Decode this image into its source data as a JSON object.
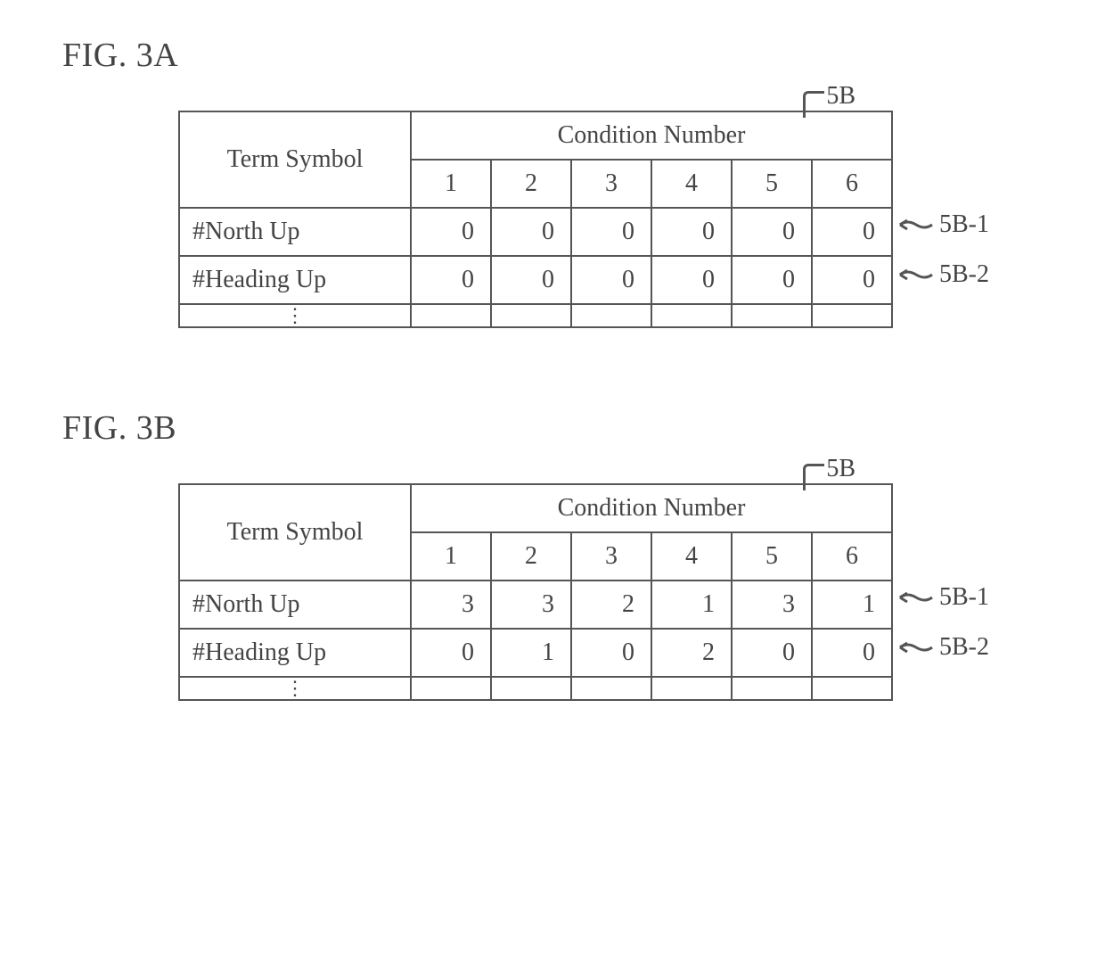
{
  "figures": {
    "a": {
      "label": "FIG. 3A",
      "table_ref": "5B",
      "row_refs": [
        "5B-1",
        "5B-2"
      ],
      "headers": {
        "term": "Term Symbol",
        "cond": "Condition Number",
        "cols": [
          "1",
          "2",
          "3",
          "4",
          "5",
          "6"
        ]
      },
      "rows": [
        {
          "term": "#North Up",
          "vals": [
            "0",
            "0",
            "0",
            "0",
            "0",
            "0"
          ]
        },
        {
          "term": "#Heading Up",
          "vals": [
            "0",
            "0",
            "0",
            "0",
            "0",
            "0"
          ]
        }
      ]
    },
    "b": {
      "label": "FIG. 3B",
      "table_ref": "5B",
      "row_refs": [
        "5B-1",
        "5B-2"
      ],
      "headers": {
        "term": "Term Symbol",
        "cond": "Condition Number",
        "cols": [
          "1",
          "2",
          "3",
          "4",
          "5",
          "6"
        ]
      },
      "rows": [
        {
          "term": "#North Up",
          "vals": [
            "3",
            "3",
            "2",
            "1",
            "3",
            "1"
          ]
        },
        {
          "term": "#Heading Up",
          "vals": [
            "0",
            "1",
            "0",
            "2",
            "0",
            "0"
          ]
        }
      ]
    }
  },
  "ellipsis": "⋮"
}
